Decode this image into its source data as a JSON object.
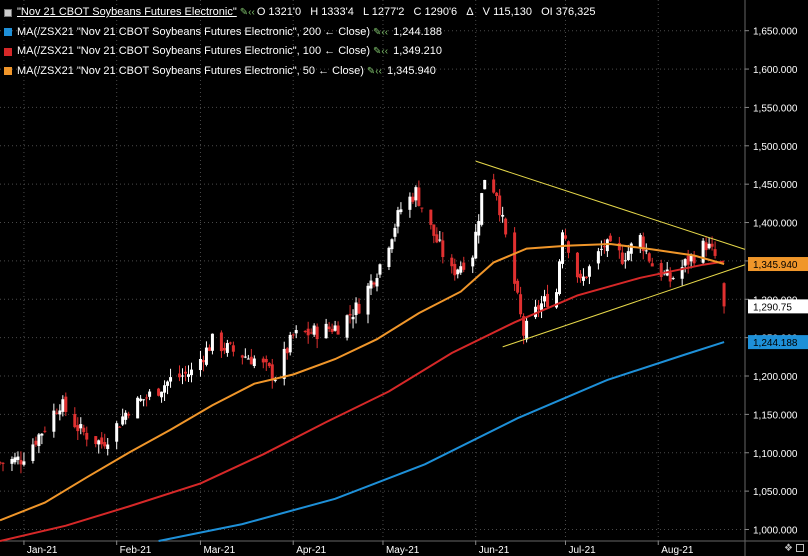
{
  "header": {
    "symbol_title": "\"Nov 21 CBOT Soybeans Futures Electronic\"",
    "ohlc": [
      "O 1321'0",
      "H 1333'4",
      "L 1277'2",
      "C 1290'6",
      "Δ",
      "V 115,130",
      "OI 376,325"
    ],
    "ma200_label": "MA(/ZSX21 \"Nov 21 CBOT Soybeans Futures Electronic\", 200 ← Close)",
    "ma200_value": "1,244.188",
    "ma100_label": "MA(/ZSX21 \"Nov 21 CBOT Soybeans Futures Electronic\", 100 ← Close)",
    "ma100_value": "1,349.210",
    "ma50_label": "MA(/ZSX21 \"Nov 21 CBOT Soybeans Futures Electronic\", 50 ← Close)",
    "ma50_value": "1,345.940"
  },
  "colors": {
    "background": "#000000",
    "grid": "#4a4a4a",
    "up_candle": "#ffffff",
    "down_candle": "#e03030",
    "ma200": "#1e90d8",
    "ma100": "#d62828",
    "ma50": "#f0962a",
    "trendline": "#e6d84a",
    "axis_text": "#ffffff"
  },
  "chart_data": {
    "type": "candlestick",
    "y_axis": {
      "range": [
        985,
        1690
      ],
      "ticks": [
        "1,000.000",
        "1,050.000",
        "1,100.000",
        "1,150.000",
        "1,200.000",
        "1,250.000",
        "1,300.000",
        "1,350.000",
        "1,400.000",
        "1,450.000",
        "1,500.000",
        "1,550.000",
        "1,600.000",
        "1,650.000"
      ],
      "tick_values": [
        1000,
        1050,
        1100,
        1150,
        1200,
        1250,
        1300,
        1350,
        1400,
        1450,
        1500,
        1550,
        1600,
        1650
      ]
    },
    "x_axis": {
      "range": [
        "2020-12-24",
        "2021-08-30"
      ],
      "ticks": [
        "Jan-21",
        "Feb-21",
        "Mar-21",
        "Apr-21",
        "May-21",
        "Jun-21",
        "Jul-21",
        "Aug-21"
      ],
      "tick_dates": [
        "2021-01-01",
        "2021-02-01",
        "2021-03-01",
        "2021-04-01",
        "2021-05-01",
        "2021-06-01",
        "2021-07-01",
        "2021-08-01"
      ]
    },
    "grid": true,
    "price_labels": [
      {
        "value": 1345.94,
        "text": "1,345.940",
        "color": "#f0962a"
      },
      {
        "value": 1290.75,
        "text": "1,290.75",
        "color": "#ffffff"
      },
      {
        "value": 1244.188,
        "text": "1,244.188",
        "color": "#1e90d8"
      }
    ],
    "close_anchors": [
      [
        "2020-12-24",
        1087
      ],
      [
        "2020-12-31",
        1092
      ],
      [
        "2021-01-07",
        1128
      ],
      [
        "2021-01-13",
        1165
      ],
      [
        "2021-01-20",
        1128
      ],
      [
        "2021-01-27",
        1112
      ],
      [
        "2021-02-01",
        1135
      ],
      [
        "2021-02-05",
        1158
      ],
      [
        "2021-02-12",
        1175
      ],
      [
        "2021-02-19",
        1195
      ],
      [
        "2021-02-26",
        1205
      ],
      [
        "2021-03-05",
        1245
      ],
      [
        "2021-03-12",
        1232
      ],
      [
        "2021-03-19",
        1222
      ],
      [
        "2021-03-26",
        1200
      ],
      [
        "2021-04-01",
        1252
      ],
      [
        "2021-04-09",
        1258
      ],
      [
        "2021-04-16",
        1265
      ],
      [
        "2021-04-23",
        1292
      ],
      [
        "2021-04-30",
        1345
      ],
      [
        "2021-05-07",
        1418
      ],
      [
        "2021-05-12",
        1440
      ],
      [
        "2021-05-17",
        1392
      ],
      [
        "2021-05-24",
        1335
      ],
      [
        "2021-05-31",
        1360
      ],
      [
        "2021-06-04",
        1460
      ],
      [
        "2021-06-08",
        1440
      ],
      [
        "2021-06-14",
        1320
      ],
      [
        "2021-06-17",
        1255
      ],
      [
        "2021-06-22",
        1290
      ],
      [
        "2021-06-28",
        1310
      ],
      [
        "2021-06-30",
        1395
      ],
      [
        "2021-07-06",
        1320
      ],
      [
        "2021-07-09",
        1340
      ],
      [
        "2021-07-14",
        1370
      ],
      [
        "2021-07-20",
        1355
      ],
      [
        "2021-07-26",
        1380
      ],
      [
        "2021-07-30",
        1345
      ],
      [
        "2021-08-05",
        1325
      ],
      [
        "2021-08-11",
        1350
      ],
      [
        "2021-08-17",
        1372
      ],
      [
        "2021-08-20",
        1355
      ],
      [
        "2021-08-23",
        1290.75
      ]
    ],
    "moving_averages": {
      "ma50": [
        [
          "2020-12-24",
          1012
        ],
        [
          "2021-01-08",
          1035
        ],
        [
          "2021-01-22",
          1068
        ],
        [
          "2021-02-05",
          1100
        ],
        [
          "2021-02-19",
          1130
        ],
        [
          "2021-03-05",
          1162
        ],
        [
          "2021-03-19",
          1190
        ],
        [
          "2021-04-01",
          1202
        ],
        [
          "2021-04-15",
          1222
        ],
        [
          "2021-04-29",
          1248
        ],
        [
          "2021-05-13",
          1282
        ],
        [
          "2021-05-27",
          1310
        ],
        [
          "2021-06-07",
          1348
        ],
        [
          "2021-06-18",
          1366
        ],
        [
          "2021-07-02",
          1370
        ],
        [
          "2021-07-16",
          1372
        ],
        [
          "2021-07-30",
          1365
        ],
        [
          "2021-08-13",
          1357
        ],
        [
          "2021-08-23",
          1345.94
        ]
      ],
      "ma100": [
        [
          "2020-12-24",
          985
        ],
        [
          "2021-01-15",
          1005
        ],
        [
          "2021-02-05",
          1030
        ],
        [
          "2021-03-01",
          1060
        ],
        [
          "2021-03-22",
          1098
        ],
        [
          "2021-04-12",
          1140
        ],
        [
          "2021-05-03",
          1180
        ],
        [
          "2021-05-24",
          1230
        ],
        [
          "2021-06-14",
          1270
        ],
        [
          "2021-07-05",
          1305
        ],
        [
          "2021-07-26",
          1328
        ],
        [
          "2021-08-16",
          1345
        ],
        [
          "2021-08-23",
          1349.21
        ]
      ],
      "ma200": [
        [
          "2021-02-15",
          985
        ],
        [
          "2021-03-15",
          1007
        ],
        [
          "2021-04-15",
          1040
        ],
        [
          "2021-05-15",
          1085
        ],
        [
          "2021-06-15",
          1145
        ],
        [
          "2021-07-15",
          1195
        ],
        [
          "2021-08-10",
          1228
        ],
        [
          "2021-08-23",
          1244.188
        ]
      ]
    },
    "trendlines": [
      {
        "from": [
          "2021-06-01",
          1480
        ],
        "to": [
          "2021-08-30",
          1365
        ]
      },
      {
        "from": [
          "2021-06-10",
          1238
        ],
        "to": [
          "2021-08-30",
          1345
        ]
      }
    ]
  }
}
